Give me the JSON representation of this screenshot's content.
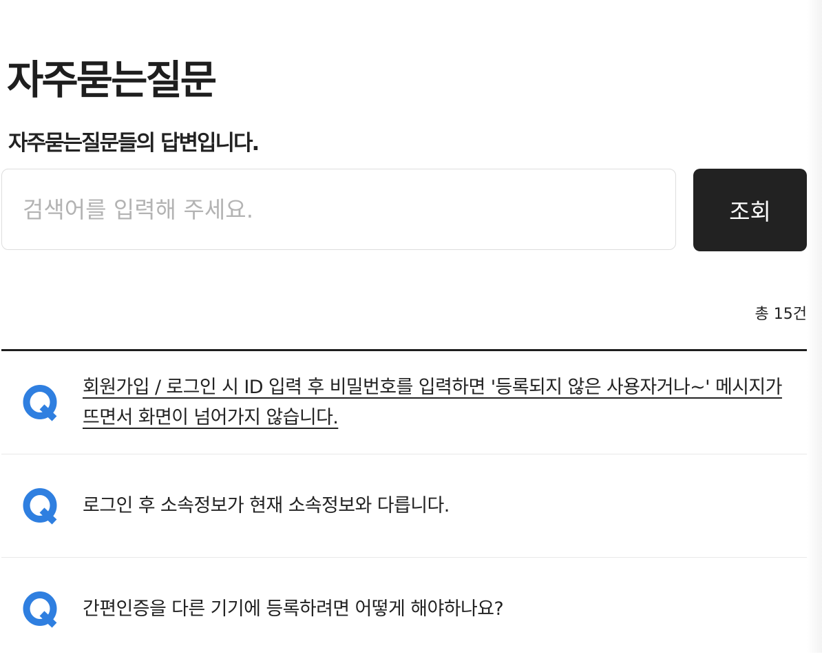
{
  "header": {
    "title": "자주묻는질문",
    "subtitle": "자주묻는질문들의 답변입니다."
  },
  "search": {
    "placeholder": "검색어를 입력해 주세요.",
    "value": "",
    "button_label": "조회"
  },
  "list": {
    "total": "총 15건",
    "icon": "q-icon",
    "accent_color": "#2f7fe0",
    "items": [
      {
        "question": "회원가입 / 로그인 시 ID 입력 후 비밀번호를 입력하면 '등록되지 않은 사용자거나~' 메시지가 뜨면서 화면이 넘어가지 않습니다."
      },
      {
        "question": "로그인 후 소속정보가 현재 소속정보와 다릅니다."
      },
      {
        "question": "간편인증을 다른 기기에 등록하려면 어떻게 해야하나요?"
      }
    ]
  }
}
